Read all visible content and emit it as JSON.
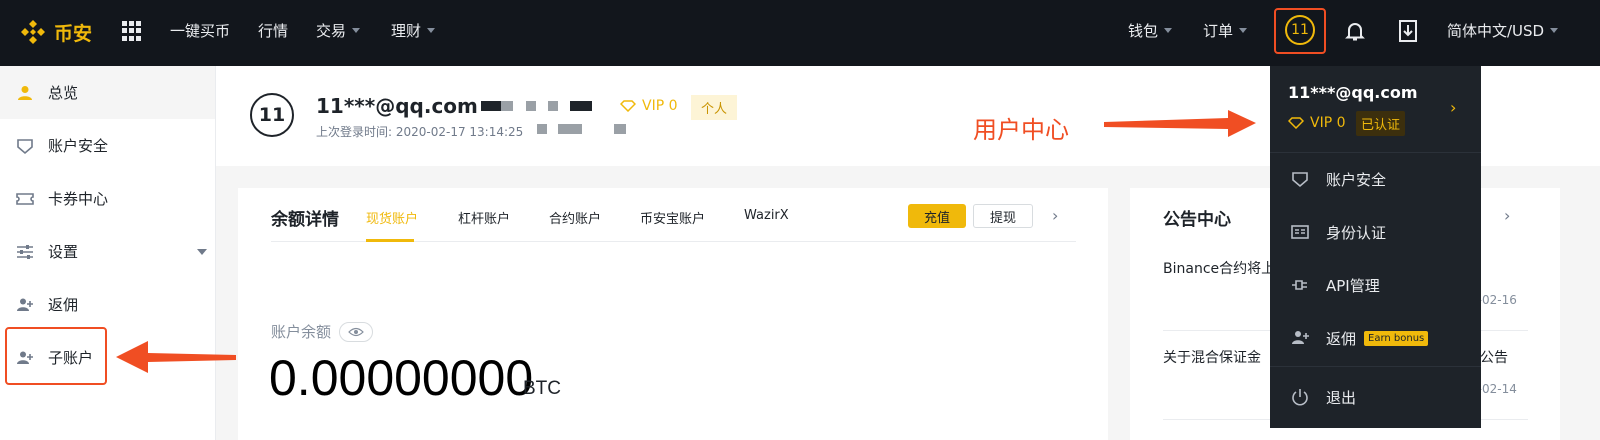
{
  "topbar": {
    "logo_text": "币安",
    "nav_left": [
      "一键买币",
      "行情",
      "交易",
      "理财"
    ],
    "nav_right": [
      "钱包",
      "订单"
    ],
    "avatar_label": "11",
    "language": "简体中文/USD"
  },
  "sidebar": {
    "items": [
      {
        "label": "总览",
        "icon": "user-icon"
      },
      {
        "label": "账户安全",
        "icon": "shield-icon"
      },
      {
        "label": "卡券中心",
        "icon": "ticket-icon"
      },
      {
        "label": "设置",
        "icon": "settings-sliders-icon"
      },
      {
        "label": "返佣",
        "icon": "user-plus-icon"
      },
      {
        "label": "子账户",
        "icon": "user-plus-icon"
      }
    ]
  },
  "profile": {
    "avatar_label": "11",
    "email": "11***@qq.com",
    "last_login": "上次登录时间: 2020-02-17 13:14:25",
    "vip": "VIP 0",
    "account_type": "个人"
  },
  "annotation": {
    "user_center": "用户中心"
  },
  "balance": {
    "title": "余额详情",
    "tabs": [
      "现货账户",
      "杠杆账户",
      "合约账户",
      "币安宝账户",
      "WazirX"
    ],
    "active_tab": 0,
    "deposit_label": "充值",
    "withdraw_label": "提现",
    "account_balance_label": "账户余额",
    "amount": "0.00000000",
    "unit": "BTC"
  },
  "announcements": {
    "title": "公告中心",
    "items": [
      {
        "text": "Binance合约将上",
        "date": "0-02-16"
      },
      {
        "text": "关于混合保证金",
        "suffix": "公告",
        "date": "0-02-14"
      }
    ]
  },
  "dropdown": {
    "email": "11***@qq.com",
    "vip": "VIP 0",
    "verified": "已认证",
    "items": [
      {
        "label": "账户安全",
        "icon": "shield-icon"
      },
      {
        "label": "身份认证",
        "icon": "id-card-icon"
      },
      {
        "label": "API管理",
        "icon": "api-plug-icon"
      },
      {
        "label": "返佣",
        "icon": "user-plus-icon",
        "badge": "Earn bonus"
      },
      {
        "label": "退出",
        "icon": "power-icon"
      }
    ]
  },
  "colors": {
    "brand": "#f0b90b",
    "annotation": "#f04e23",
    "topbar_bg": "#12161c"
  }
}
